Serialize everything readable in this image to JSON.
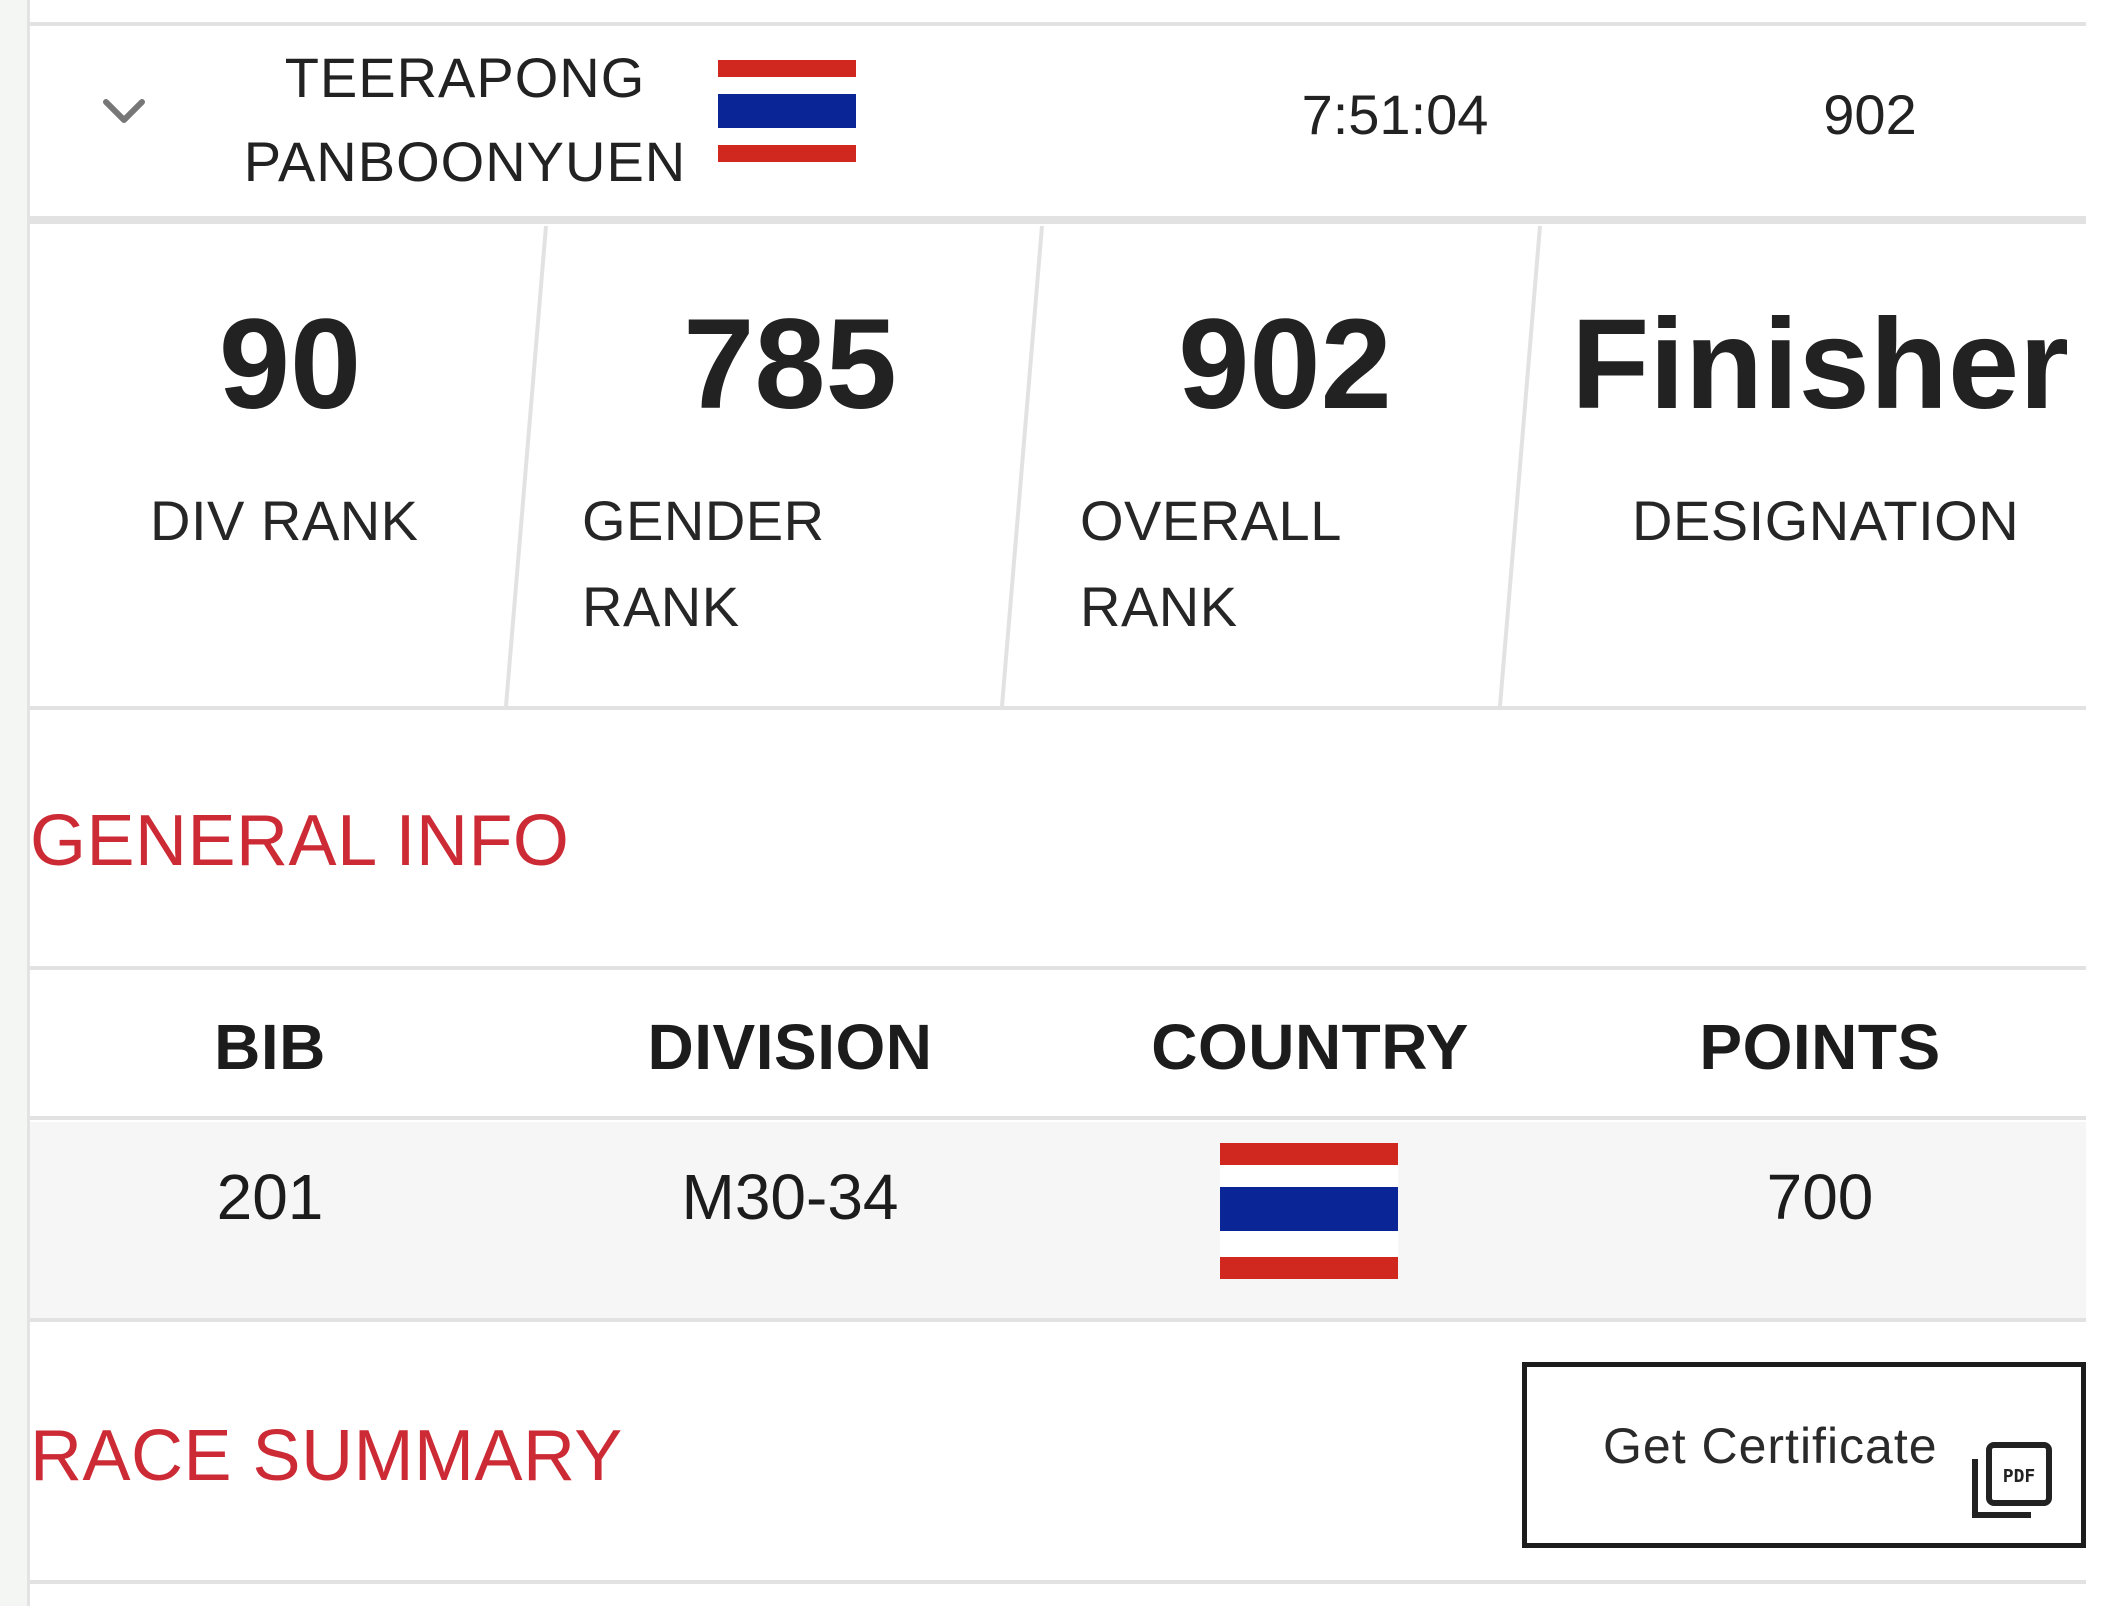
{
  "athlete": {
    "first_name": "TEERAPONG",
    "last_name": "PANBOONYUEN",
    "country_flag": "thailand-flag",
    "finish_time": "7:51:04",
    "overall_rank": "902",
    "toggle_icon": "chevron-down-icon"
  },
  "stats": [
    {
      "value": "90",
      "label_lines": [
        "DIV RANK"
      ]
    },
    {
      "value": "785",
      "label_lines": [
        "GENDER",
        "RANK"
      ]
    },
    {
      "value": "902",
      "label_lines": [
        "OVERALL",
        "RANK"
      ]
    },
    {
      "value": "Finisher",
      "label_lines": [
        "DESIGNATION"
      ]
    }
  ],
  "general_info": {
    "title": "GENERAL INFO",
    "headers": {
      "bib": "BIB",
      "division": "DIVISION",
      "country": "COUNTRY",
      "points": "POINTS"
    },
    "values": {
      "bib": "201",
      "division": "M30-34",
      "country_flag": "thailand-flag",
      "points": "700"
    }
  },
  "race_summary": {
    "title": "RACE SUMMARY",
    "certificate_button": "Get Certificate",
    "certificate_icon": "pdf-icon"
  },
  "colors": {
    "accent_red": "#cc2a35",
    "flag_red": "#d0281f",
    "flag_blue": "#0a2595",
    "divider": "#e2e2e2"
  }
}
